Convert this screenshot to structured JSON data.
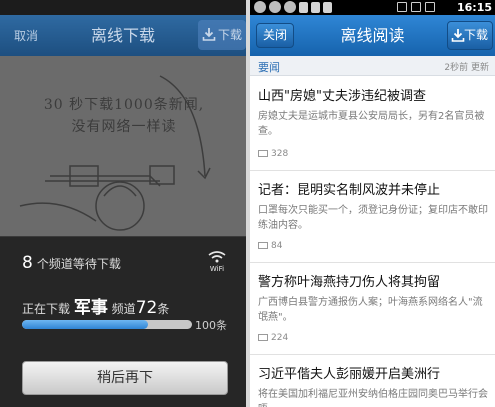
{
  "left_panel": {
    "header": {
      "close_label": "取消",
      "title": "离线下载",
      "download_label": "下载"
    },
    "illustration_text_line1": "30 秒下载1000条新闻,",
    "illustration_text_line2": "没有网络一样读",
    "dialog": {
      "channels_waiting_count": "8",
      "channels_waiting_text": "个频道等待下载",
      "wifi_label": "WiFi",
      "downloading_prefix": "正在下载",
      "downloading_channel": "军事",
      "channel_word": "频道",
      "downloading_count": "72",
      "count_unit": "条",
      "progress_fraction": 0.74,
      "progress_total": "100条",
      "later_button": "稍后再下"
    }
  },
  "right_panel": {
    "status_time": "16:15",
    "header": {
      "close_label": "关闭",
      "title": "离线阅读",
      "download_label": "下载"
    },
    "section": {
      "name": "要闻",
      "updated": "2秒前 更新"
    },
    "news": [
      {
        "headline": "山西\"房媳\"丈夫涉违纪被调查",
        "summary": "房媳丈夫是运城市夏县公安局局长，另有2名官员被查。",
        "comments": "328"
      },
      {
        "headline": "记者：昆明实名制风波并未停止",
        "summary": "口罩每次只能买一个，须登记身份证；复印店不敢印练油内容。",
        "comments": "84"
      },
      {
        "headline": "警方称叶海燕持刀伤人将其拘留",
        "summary": "广西博白县警方通报伤人案；叶海燕系网络名人\"流氓燕\"。",
        "comments": "224"
      },
      {
        "headline": "习近平偕夫人彭丽媛开启美洲行",
        "summary": "将在美国加利福尼亚州安纳伯格庄园同奥巴马举行会晤。",
        "comments": ""
      }
    ]
  },
  "colors": {
    "accent": "#1d6fc0",
    "section": "#2c6fb4",
    "progress": "#2f84d4"
  }
}
